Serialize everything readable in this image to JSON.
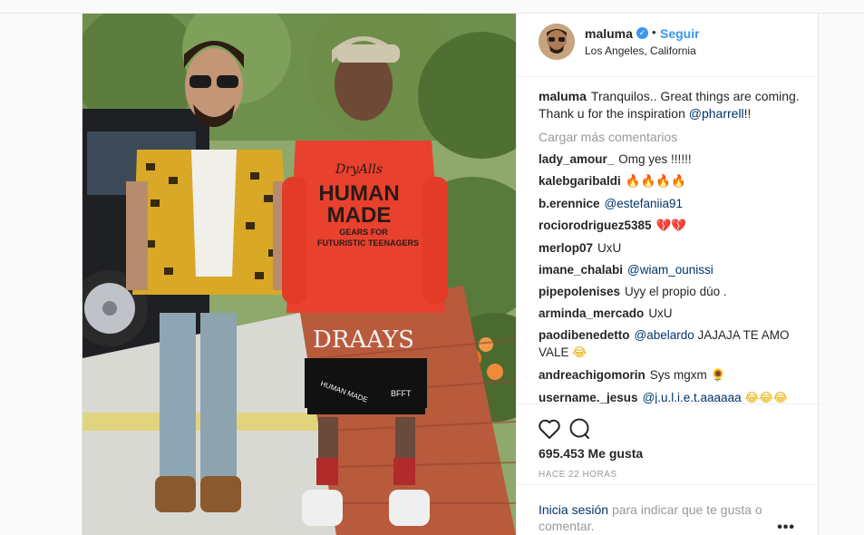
{
  "post": {
    "username": "maluma",
    "follow_label": "Seguir",
    "dot": "•",
    "verified_glyph": "✓",
    "location": "Los Angeles, California",
    "caption_user": "maluma",
    "caption_text": "Tranquilos.. Great things are coming. Thank u for the inspiration",
    "caption_mention": "@pharrell",
    "caption_suffix": "!!",
    "load_more": "Cargar más comentarios"
  },
  "comments": [
    {
      "user": "lady_amour_",
      "text": "Omg yes !!!!!!",
      "mention": "",
      "emoji": ""
    },
    {
      "user": "kalebgaribaldi",
      "text": "",
      "mention": "",
      "emoji": "🔥🔥🔥🔥"
    },
    {
      "user": "b.erennice",
      "text": "",
      "mention": "@estefaniia91",
      "emoji": ""
    },
    {
      "user": "rociorodriguez5385",
      "text": "",
      "mention": "",
      "emoji": "💔💔"
    },
    {
      "user": "merlop07",
      "text": "UxU",
      "mention": "",
      "emoji": ""
    },
    {
      "user": "imane_chalabi",
      "text": "",
      "mention": "@wiam_ounissi",
      "emoji": ""
    },
    {
      "user": "pipepolenises",
      "text": "Uyy el propio dúo .",
      "mention": "",
      "emoji": ""
    },
    {
      "user": "arminda_mercado",
      "text": "UxU",
      "mention": "",
      "emoji": ""
    },
    {
      "user": "paodibenedetto",
      "mention": "@abelardo",
      "text": "JAJAJA TE AMO VALE",
      "emoji": "😂"
    },
    {
      "user": "andreachigomorin",
      "text": "Sys mgxm",
      "mention": "",
      "emoji": "🌻"
    },
    {
      "user": "username._jesus",
      "mention": "@j.u.l.i.e.t.aaaaaa",
      "text": "",
      "emoji": "😂😂😂"
    }
  ],
  "actions": {
    "likes": "695.453 Me gusta",
    "time": "HACE 22 HORAS"
  },
  "login": {
    "link": "Inicia sesión",
    "text": "para indicar que te gusta o comentar.",
    "more": "•••"
  },
  "photo": {
    "hoodie_line1": "DryAlls",
    "hoodie_line2": "HUMAN",
    "hoodie_line3": "MADE",
    "hoodie_line4": "GEARS FOR",
    "hoodie_line5": "FUTURISTIC TEENAGERS",
    "shorts_text": "DRAAYS",
    "shorts_left": "HUMAN MADE",
    "shorts_right": "BFFT"
  }
}
